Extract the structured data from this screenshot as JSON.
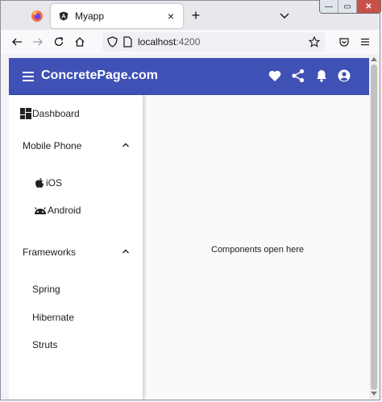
{
  "browser": {
    "tab_title": "Myapp",
    "tab_close": "×",
    "new_tab": "+",
    "url_host": "localhost",
    "url_port": ":4200",
    "window_controls": {
      "minimize": "—",
      "maximize": "▭",
      "close": "✕"
    }
  },
  "app": {
    "brand": "ConcretePage.com",
    "toolbar_color": "#3f51b5",
    "toolbar_icons": [
      "favorite-icon",
      "share-icon",
      "notifications-icon",
      "account-circle-icon"
    ]
  },
  "sidenav": {
    "dashboard": "Dashboard",
    "sections": [
      {
        "label": "Mobile Phone",
        "expanded": true,
        "items": [
          "iOS",
          "Android"
        ]
      },
      {
        "label": "Frameworks",
        "expanded": true,
        "items": [
          "Spring",
          "Hibernate",
          "Struts"
        ]
      }
    ]
  },
  "content": {
    "message": "Components open here"
  }
}
